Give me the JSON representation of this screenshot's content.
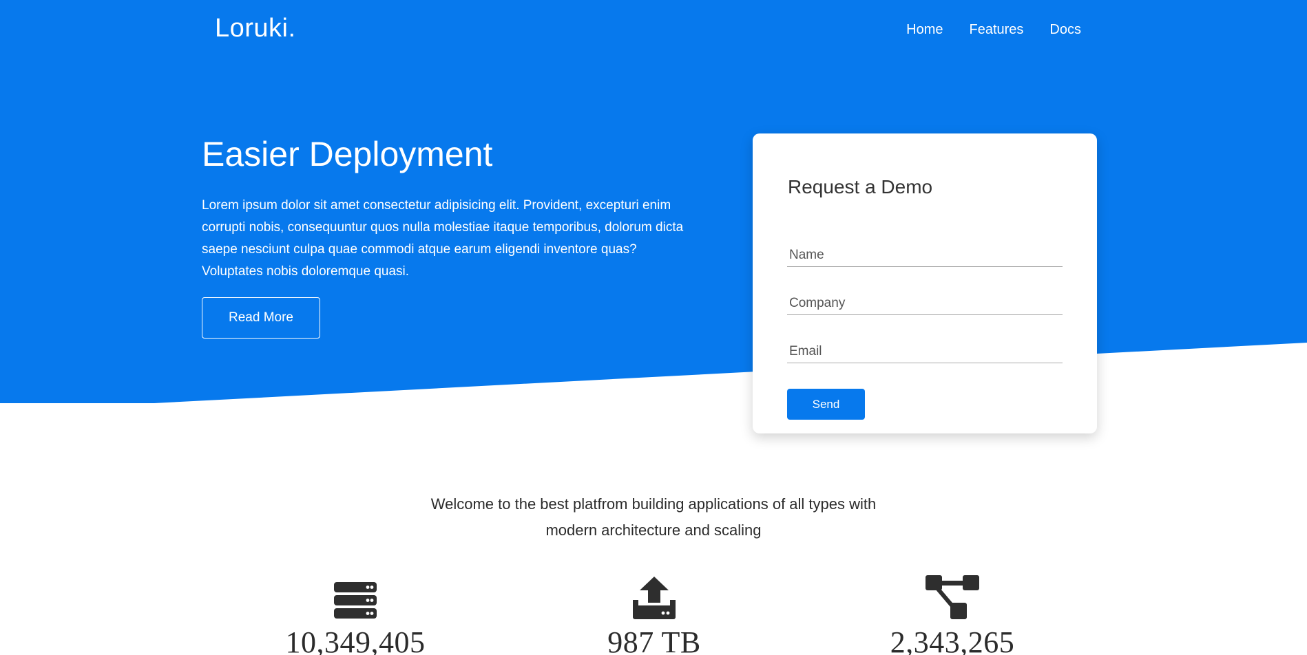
{
  "brand": {
    "logo_text": "Loruki."
  },
  "nav": {
    "items": [
      "Home",
      "Features",
      "Docs"
    ]
  },
  "hero": {
    "title": "Easier Deployment",
    "description": "Lorem ipsum dolor sit amet consectetur adipisicing elit. Provident, excepturi enim corrupti nobis, consequuntur quos nulla molestiae itaque temporibus, dolorum dicta saepe nesciunt culpa quae commodi atque earum eligendi inventore quas? Voluptates nobis doloremque quasi.",
    "read_more_label": "Read More"
  },
  "demo_form": {
    "title": "Request a Demo",
    "name_placeholder": "Name",
    "company_placeholder": "Company",
    "email_placeholder": "Email",
    "send_label": "Send"
  },
  "welcome": {
    "text": "Welcome to the best platfrom building applications of all types with modern architecture and scaling"
  },
  "stats": [
    {
      "icon": "server-icon",
      "value": "10,349,405"
    },
    {
      "icon": "upload-icon",
      "value": "987 TB"
    },
    {
      "icon": "network-icon",
      "value": "2,343,265"
    }
  ],
  "colors": {
    "primary": "#0779ed",
    "text": "#2b2b2b",
    "white": "#ffffff"
  }
}
